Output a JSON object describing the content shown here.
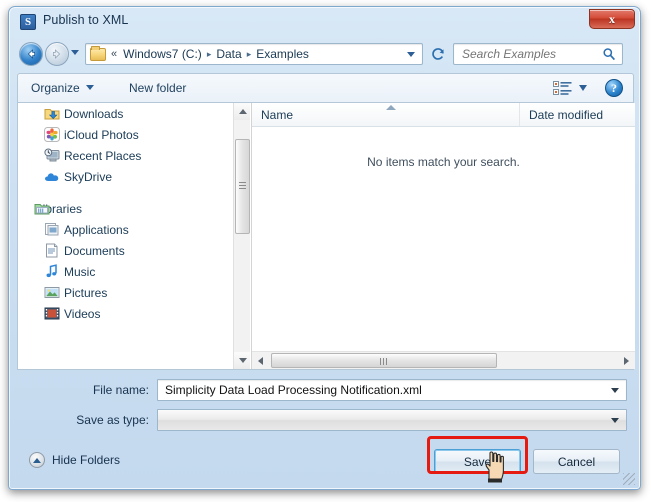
{
  "window": {
    "title": "Publish to XML",
    "icon": "simplicity-s-icon",
    "close_label": "x"
  },
  "navbar": {
    "back_icon": "back-arrow-icon",
    "forward_icon": "forward-arrow-icon",
    "recent_icon": "recent-locations-chevron-icon",
    "breadcrumb": {
      "folder_icon": "folder-icon",
      "overflow": "«",
      "items": [
        "Windows7 (C:)",
        "Data",
        "Examples"
      ],
      "separator": "▸"
    },
    "refresh_icon": "refresh-icon",
    "search": {
      "placeholder": "Search Examples",
      "value": "",
      "icon": "search-icon"
    }
  },
  "toolbar": {
    "organize_label": "Organize",
    "new_folder_label": "New folder",
    "view_icon": "list-view-icon",
    "help_label": "?"
  },
  "nav_pane": {
    "items": [
      {
        "label": "Downloads",
        "icon": "downloads-folder-icon",
        "level": "child"
      },
      {
        "label": "iCloud Photos",
        "icon": "icloud-photos-icon",
        "level": "child"
      },
      {
        "label": "Recent Places",
        "icon": "recent-places-icon",
        "level": "child"
      },
      {
        "label": "SkyDrive",
        "icon": "skydrive-cloud-icon",
        "level": "child"
      },
      {
        "label": "Libraries",
        "icon": "libraries-folder-icon",
        "level": "group"
      },
      {
        "label": "Applications",
        "icon": "applications-library-icon",
        "level": "child"
      },
      {
        "label": "Documents",
        "icon": "documents-library-icon",
        "level": "child"
      },
      {
        "label": "Music",
        "icon": "music-library-icon",
        "level": "child"
      },
      {
        "label": "Pictures",
        "icon": "pictures-library-icon",
        "level": "child"
      },
      {
        "label": "Videos",
        "icon": "videos-library-icon",
        "level": "child"
      }
    ]
  },
  "file_list": {
    "columns": [
      "Name",
      "Date modified"
    ],
    "sort_column": "Name",
    "sort_direction": "ascending",
    "rows": [],
    "empty_message": "No items match your search."
  },
  "fields": {
    "file_name_label": "File name:",
    "file_name_value": "Simplicity Data Load Processing Notification.xml",
    "save_as_type_label": "Save as type:",
    "save_as_type_value": ""
  },
  "footer": {
    "hide_folders_label": "Hide Folders",
    "save_label": "Save",
    "cancel_label": "Cancel"
  },
  "annotation": {
    "highlight_color": "#e51b12",
    "target": "save-button",
    "cursor": "hand-pointer-cursor"
  }
}
